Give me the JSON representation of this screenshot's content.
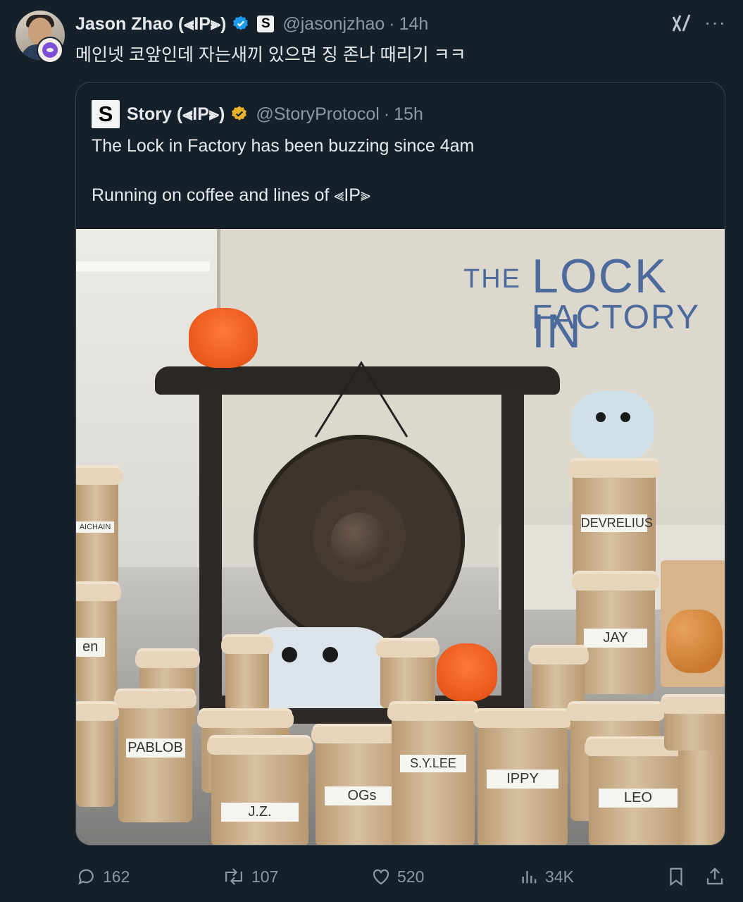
{
  "tweet": {
    "author_name": "Jason Zhao",
    "name_suffix_open": "(",
    "name_suffix_close": ")",
    "ip_text": "IP",
    "handle": "@jasonjzhao",
    "separator": "·",
    "time": "14h",
    "text": "메인넷 코앞인데 자는새끼 있으면 징 존나 때리기 ㅋㅋ"
  },
  "quote": {
    "author_name": "Story",
    "name_suffix_open": "(",
    "name_suffix_close": ")",
    "ip_text": "IP",
    "handle": "@StoryProtocol",
    "separator": "·",
    "time": "15h",
    "line1": "The Lock in Factory has been buzzing since 4am",
    "line2": "Running on coffee and lines of",
    "line2_ip": "IP"
  },
  "photo": {
    "board_the": "THE",
    "board_lock": "LOCK IN",
    "board_factory": "FACTORY",
    "cup_labels": [
      "DEVRELIUS",
      "JAY",
      "en",
      "PABLOB",
      "J.Z.",
      "OGs",
      "S.Y.LEE",
      "IPPY",
      "LEO",
      "AICHAIN"
    ]
  },
  "actions": {
    "replies": "162",
    "reposts": "107",
    "likes": "520",
    "views": "34K"
  },
  "colors": {
    "background": "#15202b",
    "muted": "#8b98a5",
    "verified_blue": "#1d9bf0",
    "verified_gold": "#e8b32a"
  },
  "icons": [
    "grok-icon",
    "more-icon",
    "verified-blue-icon",
    "verified-gold-icon",
    "reply-icon",
    "repost-icon",
    "like-icon",
    "views-icon",
    "bookmark-icon",
    "share-icon"
  ]
}
